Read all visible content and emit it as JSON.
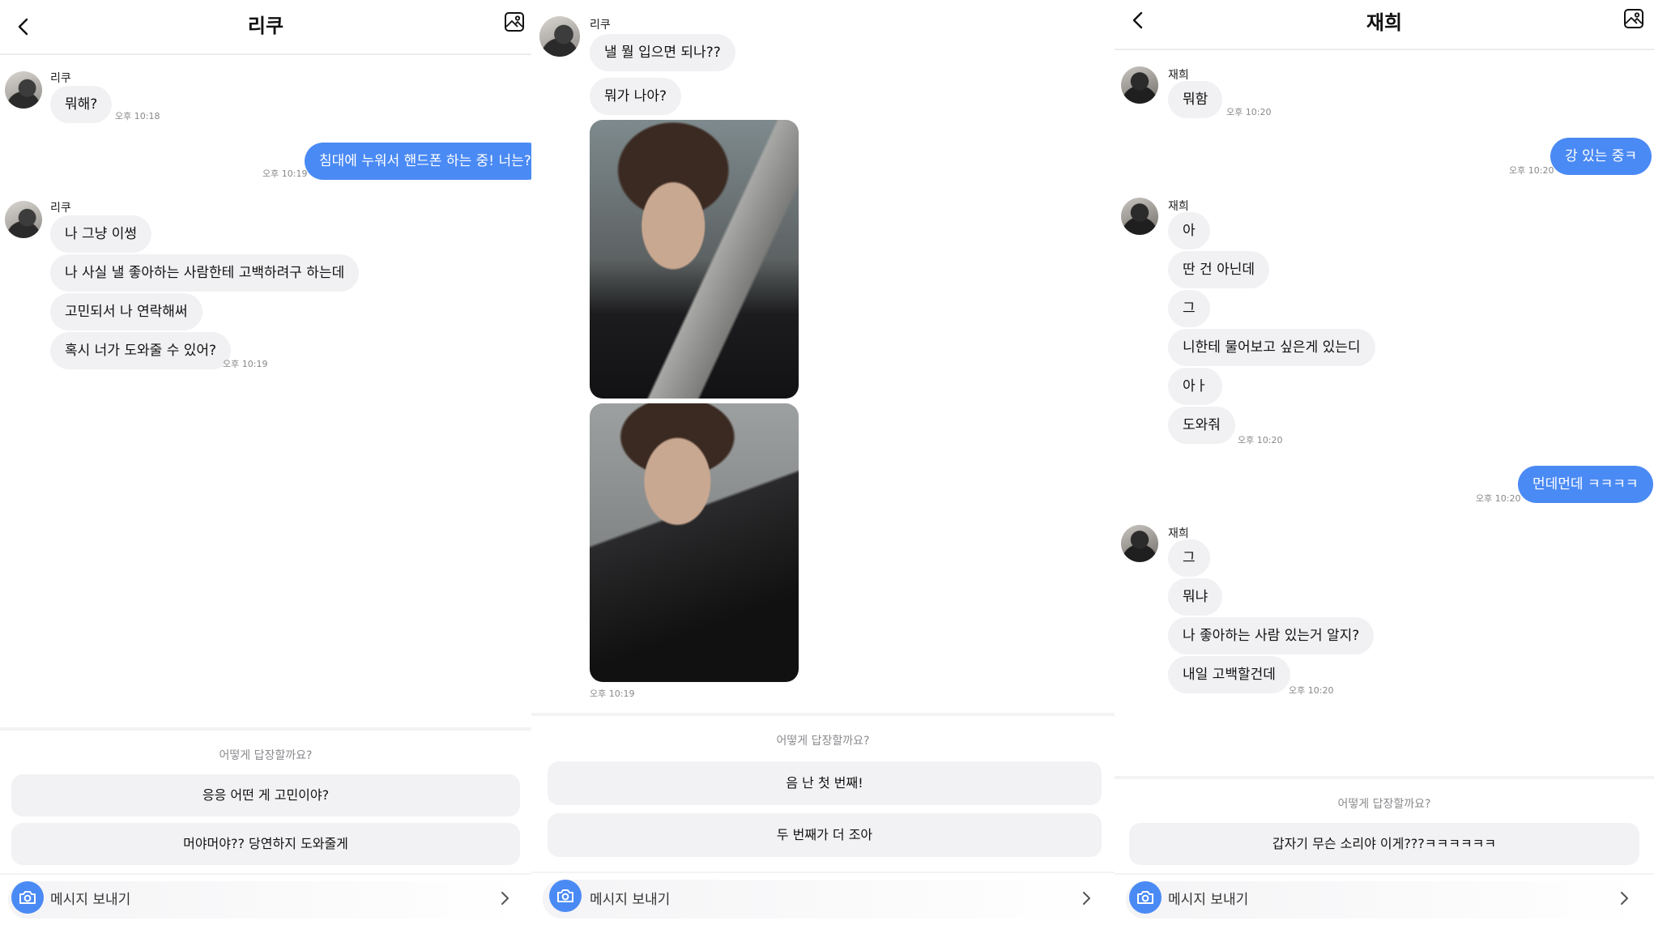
{
  "panels": [
    {
      "title": "리쿠",
      "messages": [
        {
          "sender": "리쿠",
          "texts": [
            "뭐해?"
          ],
          "time": "오후 10:18"
        },
        {
          "me": "침대에 누워서 핸드폰 하는 중! 너는?",
          "time": "오후 10:19"
        },
        {
          "sender": "리쿠",
          "texts": [
            "나 그냥 이썽",
            "나 사실 낼 좋아하는 사람한테 고백하려구 하는데",
            "고민되서 나 연락해써",
            "혹시 너가 도와줄 수 있어?"
          ],
          "time": "오후 10:19"
        }
      ],
      "reply_prompt": "어떻게 답장할까요?",
      "replies": [
        "응응 어떤 게 고민이야?",
        "머야머야?? 당연하지 도와줄게"
      ],
      "send_label": "메시지 보내기"
    },
    {
      "sender": "리쿠",
      "messages": [
        "낼 뭘 입으면 되나??",
        "뭐가 나아?"
      ],
      "time": "오후 10:19",
      "reply_prompt": "어떻게 답장할까요?",
      "replies": [
        "음 난 첫 번째!",
        "두 번째가 더 조아"
      ],
      "send_label": "메시지 보내기"
    },
    {
      "title": "재희",
      "messages": [
        {
          "sender": "재희",
          "texts": [
            "뭐함"
          ],
          "time": "오후 10:20"
        },
        {
          "me": "강 있는 중ㅋ",
          "time": "오후 10:20"
        },
        {
          "sender": "재희",
          "texts": [
            "아",
            "딴 건 아닌데",
            "그",
            "니한테 물어보고 싶은게 있는디",
            "아ㅏ",
            "도와줘"
          ],
          "time": "오후 10:20"
        },
        {
          "me": "먼데먼데 ㅋㅋㅋㅋ",
          "time": "오후 10:20"
        },
        {
          "sender": "재희",
          "texts": [
            "그",
            "뭐냐",
            "나 좋아하는 사람 있는거 알지?",
            "내일 고백할건데"
          ],
          "time": "오후 10:20"
        }
      ],
      "reply_prompt": "어떻게 답장할까요?",
      "replies": [
        "갑자기 무슨 소리야 이게???ㅋㅋㅋㅋㅋㅋ"
      ],
      "send_label": "메시지 보내기"
    }
  ],
  "colors": {
    "accent": "#4a8af4",
    "bubble": "#f1f1f3",
    "reply_button": "#f2f2f4"
  },
  "icons": [
    "back-icon",
    "image-icon",
    "camera-icon",
    "chevron-right-icon"
  ]
}
